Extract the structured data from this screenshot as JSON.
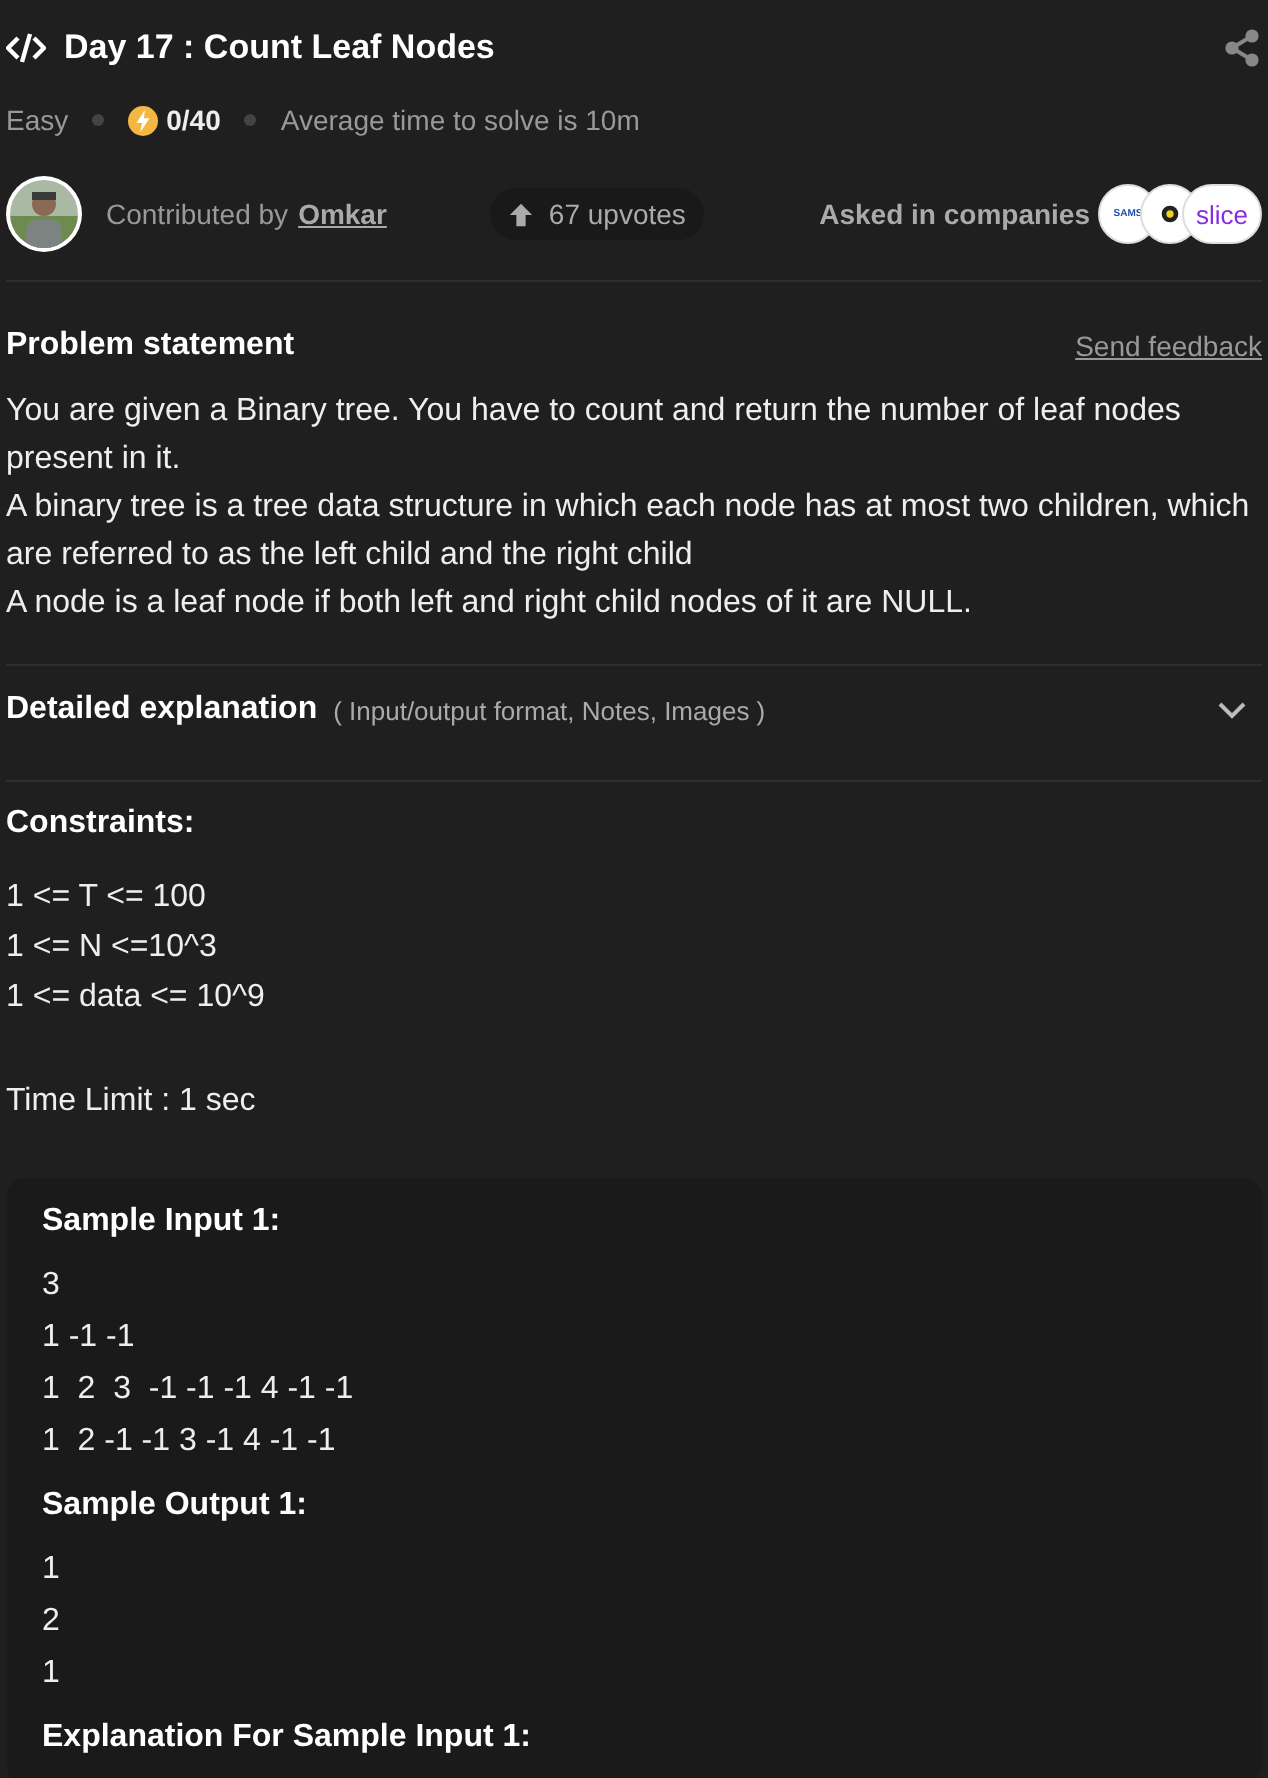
{
  "header": {
    "title": "Day 17 : Count Leaf Nodes",
    "difficulty": "Easy",
    "score": "0/40",
    "avg_time": "Average time to solve is 10m"
  },
  "contributor": {
    "prefix": "Contributed by",
    "name": "Omkar",
    "upvotes": "67 upvotes",
    "companies_label": "Asked in companies",
    "companies": [
      {
        "kind": "text",
        "label": "SAMS",
        "color": "#1f4fa8"
      },
      {
        "kind": "mark",
        "color": "#222222"
      },
      {
        "kind": "text",
        "label": "slice",
        "color": "#8a2be2"
      }
    ]
  },
  "problem": {
    "heading": "Problem statement",
    "feedback": "Send feedback",
    "paragraphs": [
      "You are given a Binary tree. You have to count and return the number of leaf nodes present in it.",
      "A binary tree is a tree data structure in which each node has at most two children, which are referred to as the left child and the right child",
      "A node is a leaf node if both left and right child nodes of it are NULL."
    ]
  },
  "details": {
    "heading": "Detailed explanation",
    "hint": "( Input/output format, Notes, Images )",
    "expanded": false
  },
  "constraints": {
    "heading": "Constraints:",
    "lines": [
      "1 <= T <= 100",
      "1 <= N <=10^3",
      "1 <= data <= 10^9"
    ],
    "time_limit": "Time Limit : 1 sec"
  },
  "samples": [
    {
      "heading": "Sample Input 1:",
      "lines": [
        "3",
        "1 -1 -1",
        "1  2  3  -1 -1 -1 4 -1 -1",
        "1  2 -1 -1 3 -1 4 -1 -1"
      ]
    },
    {
      "heading": "Sample Output 1:",
      "lines": [
        "1",
        "2",
        "1"
      ]
    },
    {
      "heading": "Explanation For Sample Input 1:"
    }
  ]
}
